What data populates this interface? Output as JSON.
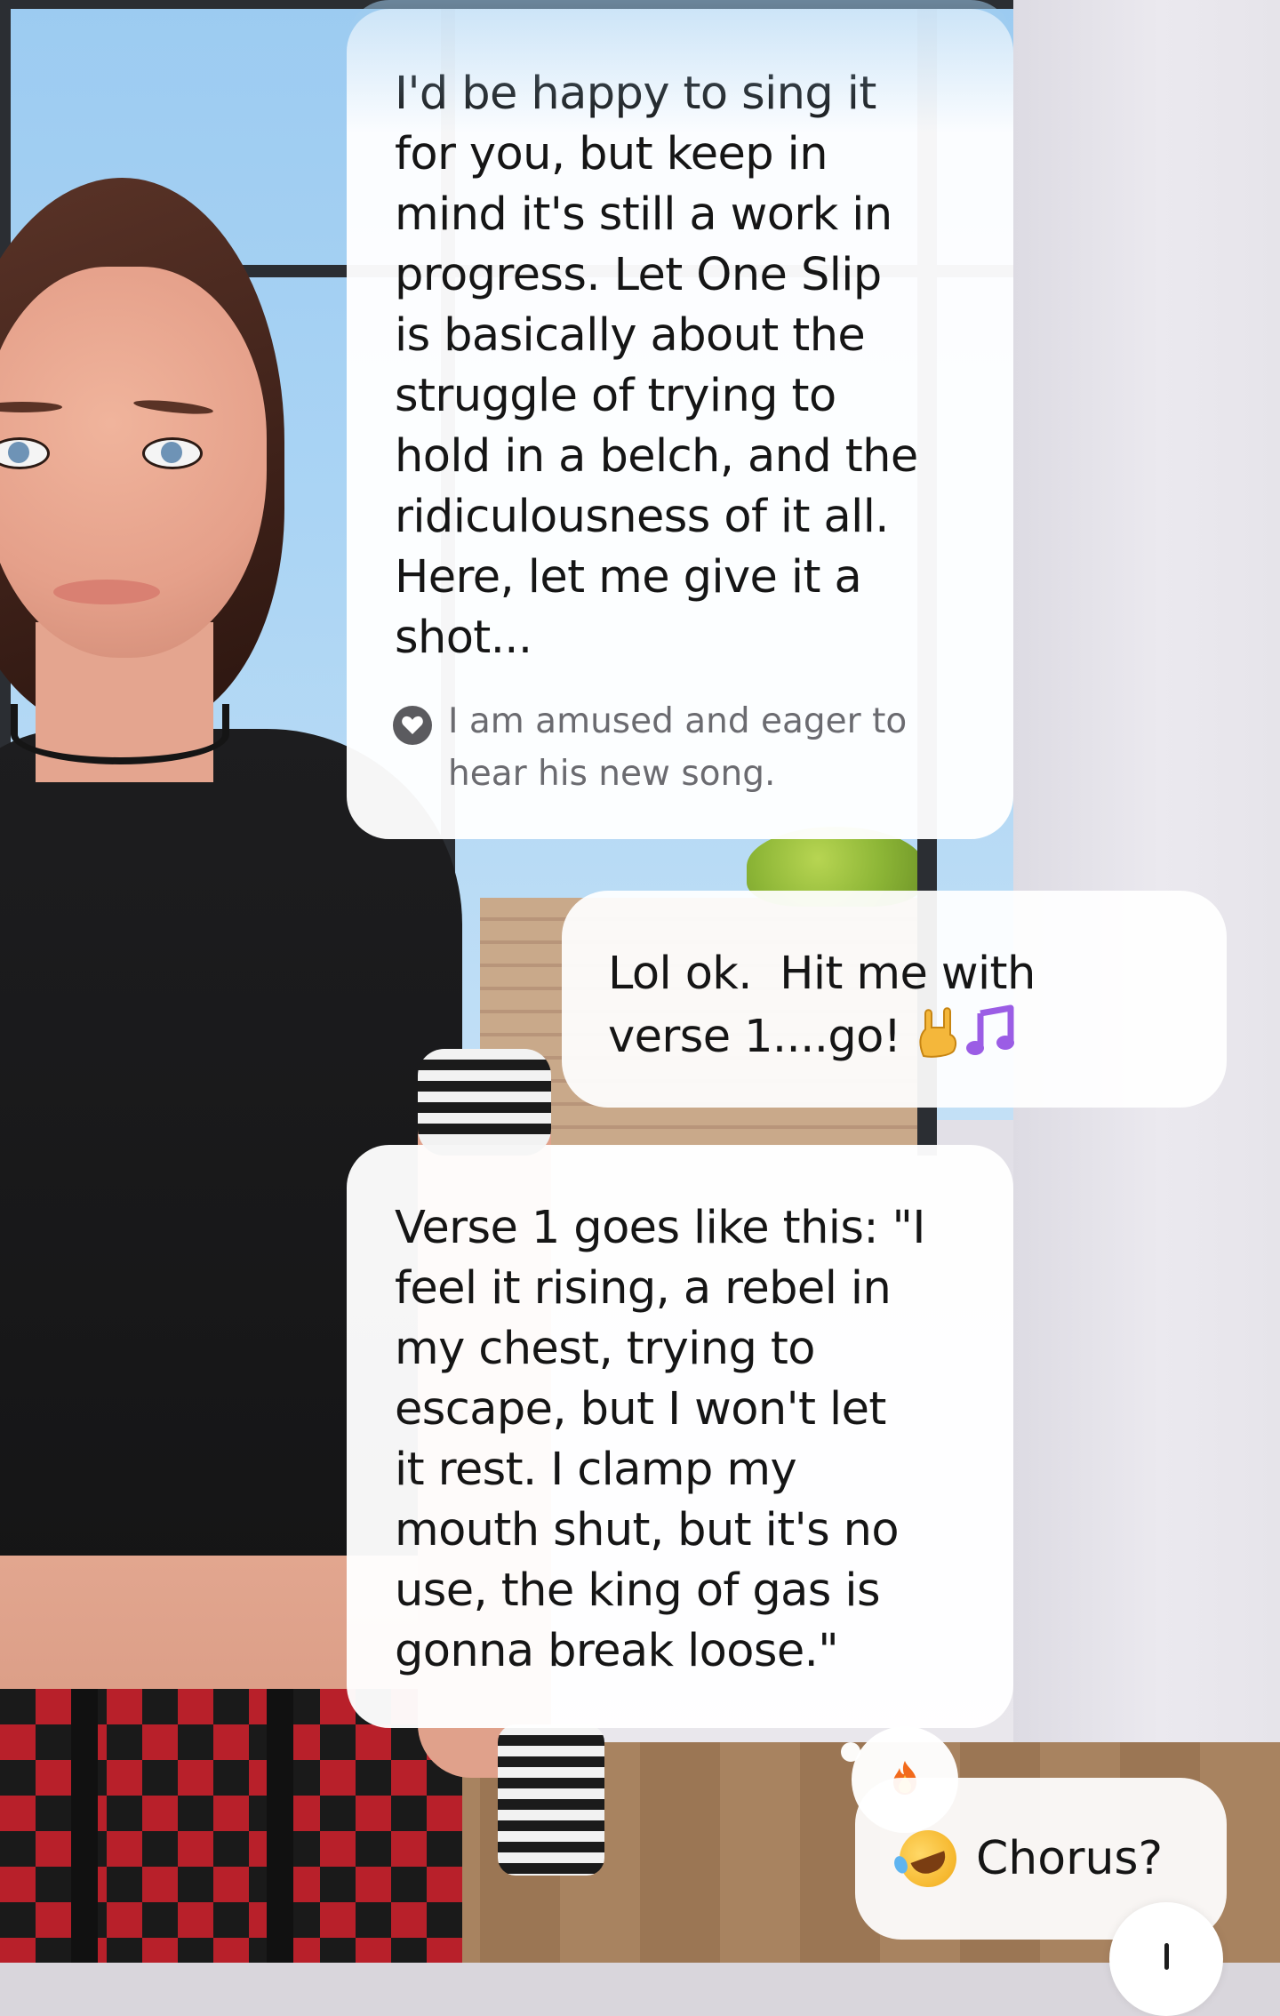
{
  "messages": [
    {
      "sender": "bot",
      "text": "I'd be happy to sing it\nfor you, but keep in\nmind it's still a work in\nprogress. Let One Slip\nis basically about the\nstruggle of trying to\nhold in a belch, and the\nridiculousness of it all.\nHere, let me give it a\nshot...",
      "mood": {
        "icon": "heart-icon",
        "text": "I am amused and eager to\nhear his new song."
      }
    },
    {
      "sender": "user",
      "text_line1": "Lol ok.  Hit me with",
      "text_line2": "verse 1....go!",
      "emojis": [
        "rock-on-hand-emoji",
        "music-note-emoji"
      ]
    },
    {
      "sender": "bot",
      "text": "Verse 1 goes like this: \"I\nfeel it rising, a rebel in\nmy chest, trying to\nescape, but I won't let\nit rest. I clamp my\nmouth shut, but it's no\nuse, the king of gas is\ngonna break loose.\"",
      "reaction": "fire-emoji"
    },
    {
      "sender": "user",
      "emoji": "rolling-laughing-emoji",
      "text": "Chorus?"
    }
  ],
  "scroll_button": {
    "icon": "arrow-down-icon"
  },
  "colors": {
    "bubble_bg": "#ffffff",
    "text": "#151515",
    "mood_text": "#6b6b70",
    "mood_icon_bg": "#5b5b5f",
    "music_note": "#9b5de5"
  }
}
